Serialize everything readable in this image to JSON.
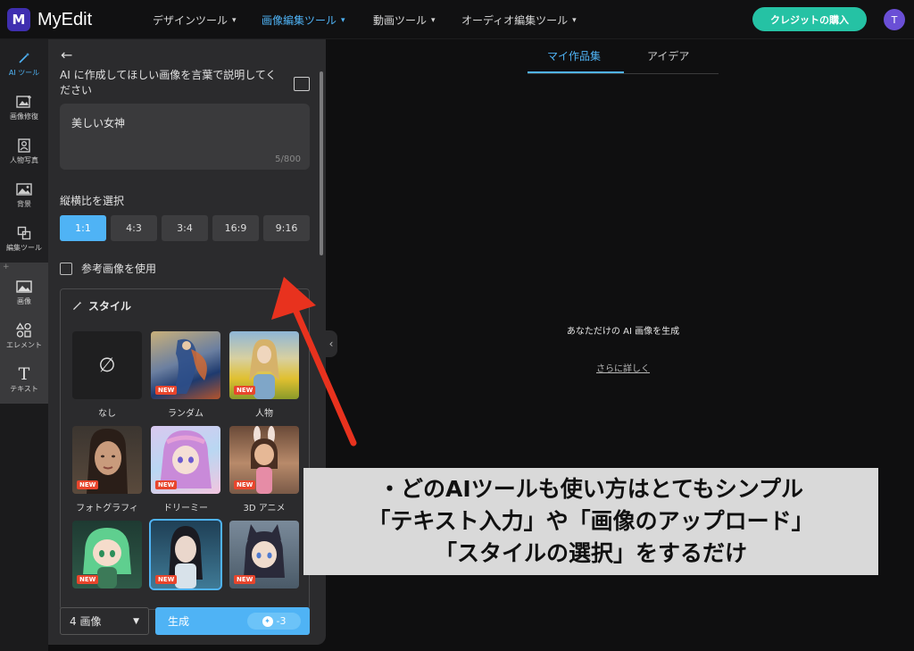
{
  "app": {
    "name": "MyEdit",
    "logo_letter": "M"
  },
  "topnav": [
    {
      "label": "デザインツール"
    },
    {
      "label": "画像編集ツール"
    },
    {
      "label": "動画ツール"
    },
    {
      "label": "オーディオ編集ツール"
    }
  ],
  "active_nav": "画像編集ツール",
  "credit_button": "クレジットの購入",
  "avatar_initial": "T",
  "rail": [
    {
      "label": "AI ツール",
      "icon": "magic-wand-icon"
    },
    {
      "label": "画像修復",
      "icon": "image-repair-icon"
    },
    {
      "label": "人物写真",
      "icon": "portrait-icon"
    },
    {
      "label": "背景",
      "icon": "background-icon"
    },
    {
      "label": "編集ツール",
      "icon": "edit-tools-icon"
    },
    {
      "label": "画像",
      "icon": "image-icon"
    },
    {
      "label": "エレメント",
      "icon": "elements-icon"
    },
    {
      "label": "テキスト",
      "icon": "text-icon"
    }
  ],
  "panel": {
    "prompt_label": "AI に作成してほしい画像を言葉で説明してください",
    "prompt_value": "美しい女神",
    "prompt_count": "5/800",
    "ratio_label": "縦横比を選択",
    "ratios": [
      "1:1",
      "4:3",
      "3:4",
      "16:9",
      "9:16"
    ],
    "selected_ratio": "1:1",
    "reference_label": "参考画像を使用",
    "style_title": "スタイル",
    "styles": [
      {
        "label": "なし",
        "new": false
      },
      {
        "label": "ランダム",
        "new": true
      },
      {
        "label": "人物",
        "new": true
      },
      {
        "label": "フォトグラフィ",
        "new": true
      },
      {
        "label": "ドリーミー",
        "new": true
      },
      {
        "label": "3D アニメ",
        "new": true
      },
      {
        "label": "",
        "new": true
      },
      {
        "label": "",
        "new": true
      },
      {
        "label": "",
        "new": true
      }
    ],
    "new_badge": "NEW",
    "none_symbol": "∅",
    "count_select": "4 画像",
    "generate_label": "生成",
    "generate_cost": "-3"
  },
  "tabs": [
    "マイ作品集",
    "アイデア"
  ],
  "empty_state": {
    "title": "あなただけの AI 画像を生成",
    "link": "さらに詳しく"
  },
  "caption": {
    "line1": "・どのAIツールも使い方はとてもシンプル",
    "line2": "「テキスト入力」や「画像のアップロード」",
    "line3": "「スタイルの選択」をするだけ"
  },
  "colors": {
    "accent": "#4fb3f5",
    "credit": "#25c2a4",
    "arrow": "#e8321e",
    "badge": "#e8452c"
  }
}
